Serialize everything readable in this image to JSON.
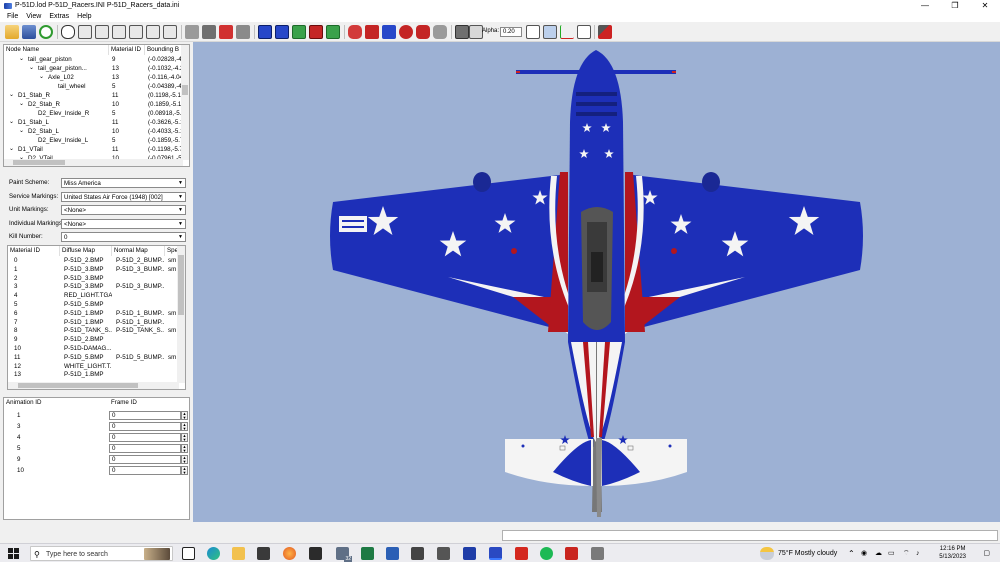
{
  "window": {
    "title": "P-51D.lod  P-51D_Racers.INI  P-51D_Racers_data.ini",
    "minimize": "—",
    "restore": "❐",
    "close": "✕"
  },
  "menu": [
    "File",
    "View",
    "Extras",
    "Help"
  ],
  "toolbar": {
    "alpha_label": "Alpha:",
    "alpha_value": "0.20"
  },
  "node_tree": {
    "columns": [
      "Node Name",
      "Material ID",
      "Bounding B"
    ],
    "rows": [
      {
        "name": "tail_gear_piston",
        "mat": "9",
        "bb": "(-0.02828,-4.",
        "indent": 2,
        "toggle": "⌄"
      },
      {
        "name": "tail_gear_piston...",
        "mat": "13",
        "bb": "(-0.1032,-4.2",
        "indent": 3,
        "toggle": "⌄"
      },
      {
        "name": "Axle_L02",
        "mat": "13",
        "bb": "(-0.116,-4.04",
        "indent": 4,
        "toggle": "⌄"
      },
      {
        "name": "tail_wheel",
        "mat": "5",
        "bb": "(-0.04389,-4.",
        "indent": 5,
        "toggle": ""
      },
      {
        "name": "D1_Stab_R",
        "mat": "11",
        "bb": "(0.1198,-5.14",
        "indent": 1,
        "toggle": "⌄"
      },
      {
        "name": "D2_Stab_R",
        "mat": "10",
        "bb": "(0.1859,-5.14",
        "indent": 2,
        "toggle": "⌄"
      },
      {
        "name": "D2_Elev_Inside_R",
        "mat": "5",
        "bb": "(0.08918,-5.7",
        "indent": 3,
        "toggle": ""
      },
      {
        "name": "D1_Stab_L",
        "mat": "11",
        "bb": "(-0.3626,-5.1",
        "indent": 1,
        "toggle": "⌄"
      },
      {
        "name": "D2_Stab_L",
        "mat": "10",
        "bb": "(-0.4033,-5.1",
        "indent": 2,
        "toggle": "⌄"
      },
      {
        "name": "D2_Elev_Inside_L",
        "mat": "5",
        "bb": "(-0.1859,-5.7",
        "indent": 3,
        "toggle": ""
      },
      {
        "name": "D1_VTail",
        "mat": "11",
        "bb": "(-0.1198,-5.7",
        "indent": 1,
        "toggle": "⌄"
      },
      {
        "name": "D2_VTail",
        "mat": "10",
        "bb": "(-0.07961,-5.",
        "indent": 2,
        "toggle": "⌄"
      }
    ]
  },
  "properties": [
    {
      "label": "Paint Scheme:",
      "value": "Miss America"
    },
    {
      "label": "Service Markings:",
      "value": "United States Air Force (1948) [002]"
    },
    {
      "label": "Unit Markings:",
      "value": "<None>"
    },
    {
      "label": "Individual Markings:",
      "value": "<None>"
    },
    {
      "label": "Kill Number:",
      "value": "0"
    }
  ],
  "materials": {
    "columns": [
      "Material ID",
      "Diffuse Map",
      "Normal Map",
      "Spe"
    ],
    "rows": [
      {
        "id": "0",
        "diffuse": "P-51D_2.BMP",
        "normal": "P-51D_2_BUMP....",
        "spec": "sm"
      },
      {
        "id": "1",
        "diffuse": "P-51D_3.BMP",
        "normal": "P-51D_3_BUMP....",
        "spec": "sm"
      },
      {
        "id": "2",
        "diffuse": "P-51D_3.BMP",
        "normal": "",
        "spec": ""
      },
      {
        "id": "3",
        "diffuse": "P-51D_3.BMP",
        "normal": "P-51D_3_BUMP....",
        "spec": ""
      },
      {
        "id": "4",
        "diffuse": "RED_LIGHT.TGA",
        "normal": "",
        "spec": ""
      },
      {
        "id": "5",
        "diffuse": "P-51D_5.BMP",
        "normal": "",
        "spec": ""
      },
      {
        "id": "6",
        "diffuse": "P-51D_1.BMP",
        "normal": "P-51D_1_BUMP....",
        "spec": "sm"
      },
      {
        "id": "7",
        "diffuse": "P-51D_1.BMP",
        "normal": "P-51D_1_BUMP....",
        "spec": ""
      },
      {
        "id": "8",
        "diffuse": "P-51D_TANK_S...",
        "normal": "P-51D_TANK_S...",
        "spec": "sm"
      },
      {
        "id": "9",
        "diffuse": "P-51D_2.BMP",
        "normal": "",
        "spec": ""
      },
      {
        "id": "10",
        "diffuse": "P-51D-DAMAG...",
        "normal": "",
        "spec": ""
      },
      {
        "id": "11",
        "diffuse": "P-51D_5.BMP",
        "normal": "P-51D_5_BUMP....",
        "spec": "sm"
      },
      {
        "id": "12",
        "diffuse": "WHITE_LIGHT.T...",
        "normal": "",
        "spec": ""
      },
      {
        "id": "13",
        "diffuse": "P-51D_1.BMP",
        "normal": "",
        "spec": ""
      }
    ]
  },
  "animation": {
    "columns": [
      "Animation ID",
      "Frame ID"
    ],
    "rows": [
      {
        "id": "1",
        "frame": "0"
      },
      {
        "id": "3",
        "frame": "0"
      },
      {
        "id": "4",
        "frame": "0"
      },
      {
        "id": "5",
        "frame": "0"
      },
      {
        "id": "9",
        "frame": "0"
      },
      {
        "id": "10",
        "frame": "0"
      }
    ]
  },
  "taskbar": {
    "search_placeholder": "Type here to search",
    "mail_badge": "32",
    "weather": "75°F  Mostly cloudy",
    "time": "12:16 PM",
    "date": "5/13/2023"
  },
  "colors": {
    "viewport_bg": "#9db1d4",
    "plane_blue": "#1d2fb8",
    "plane_red": "#b3161e",
    "plane_white": "#f4f4f4"
  }
}
